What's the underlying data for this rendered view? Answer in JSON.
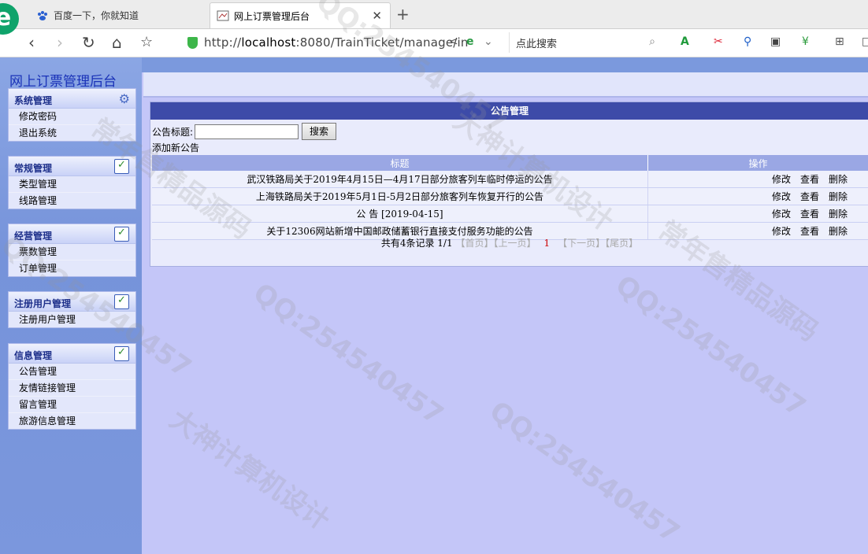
{
  "browser": {
    "tabs": [
      {
        "label": "百度一下，你就知道",
        "active": false
      },
      {
        "label": "网上订票管理后台",
        "active": true
      }
    ],
    "url_prefix": "http://",
    "url_host": "localhost",
    "url_rest": ":8080/TrainTicket/manage/in",
    "search_placeholder": "点此搜索"
  },
  "sidebar": {
    "site_title": "网上订票管理后台",
    "menus": [
      {
        "title": "系统管理",
        "icon": "gear-icon",
        "items": [
          "修改密码",
          "退出系统"
        ]
      },
      {
        "title": "常规管理",
        "icon": "edit-check-icon",
        "items": [
          "类型管理",
          "线路管理"
        ]
      },
      {
        "title": "经营管理",
        "icon": "edit-check-icon",
        "items": [
          "票数管理",
          "订单管理"
        ]
      },
      {
        "title": "注册用户管理",
        "icon": "edit-check-icon",
        "items": [
          "注册用户管理"
        ]
      },
      {
        "title": "信息管理",
        "icon": "edit-check-icon",
        "items": [
          "公告管理",
          "友情链接管理",
          "留言管理",
          "旅游信息管理"
        ]
      }
    ]
  },
  "main": {
    "panel_title": "公告管理",
    "search_label": "公告标题:",
    "search_value": "",
    "search_button": "搜索",
    "add_link": "添加新公告",
    "columns": [
      "标题",
      "操作"
    ],
    "rows": [
      {
        "title": "武汉铁路局关于2019年4月15日—4月17日部分旅客列车临时停运的公告"
      },
      {
        "title": "上海铁路局关于2019年5月1日-5月2日部分旅客列车恢复开行的公告"
      },
      {
        "title": "公 告 [2019-04-15]"
      },
      {
        "title": "关于12306网站新增中国邮政储蓄银行直接支付服务功能的公告"
      }
    ],
    "row_actions": [
      "修改",
      "查看",
      "删除"
    ],
    "pager": {
      "summary": "共有4条记录  1/1",
      "first": "【首页】",
      "prev": "【上一页】",
      "current": "1",
      "next": "【下一页】",
      "last": "【尾页】"
    }
  },
  "watermarks": [
    "QQ:254540457",
    "大神计算机设计",
    "常年售精品源码"
  ]
}
